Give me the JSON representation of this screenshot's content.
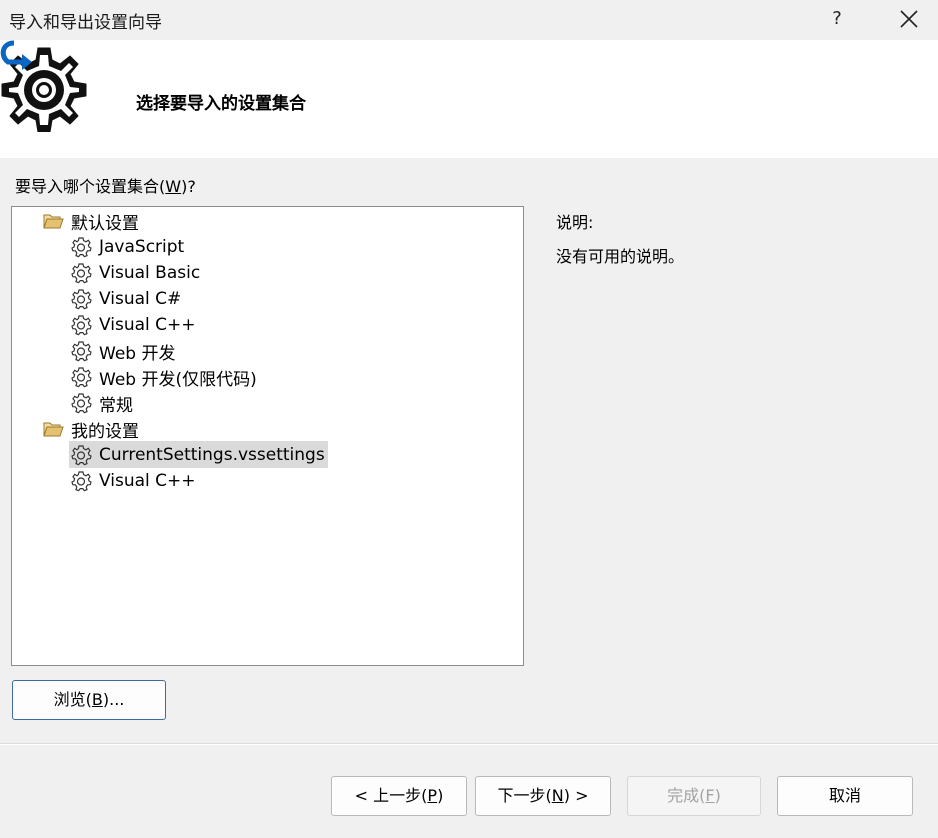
{
  "window": {
    "title": "导入和导出设置向导",
    "help_label": "?"
  },
  "header": {
    "title": "选择要导入的设置集合"
  },
  "prompt": {
    "before": "要导入哪个设置集合(",
    "accel": "W",
    "after": ")?"
  },
  "tree": {
    "groups": [
      {
        "label": "默认设置",
        "icon": "folder-open-icon",
        "items": [
          "JavaScript",
          "Visual Basic",
          "Visual C#",
          "Visual C++",
          "Web 开发",
          "Web 开发(仅限代码)",
          "常规"
        ]
      },
      {
        "label": "我的设置",
        "icon": "folder-open-icon",
        "items": [
          "CurrentSettings.vssettings",
          "Visual C++"
        ],
        "selected_index": 0
      }
    ],
    "item_icon": "gear-icon"
  },
  "description": {
    "label": "说明:",
    "text": "没有可用的说明。"
  },
  "buttons": {
    "browse": {
      "before": "浏览(",
      "accel": "B",
      "after": ")..."
    },
    "back": {
      "before": "< 上一步(",
      "accel": "P",
      "after": ")"
    },
    "next": {
      "before": "下一步(",
      "accel": "N",
      "after": ") >"
    },
    "finish": {
      "before": "完成(",
      "accel": "F",
      "after": ")"
    },
    "cancel": {
      "label": "取消"
    }
  },
  "colors": {
    "accent": "#0066cc",
    "folder": "#dcb35c",
    "selection": "#dadada"
  }
}
